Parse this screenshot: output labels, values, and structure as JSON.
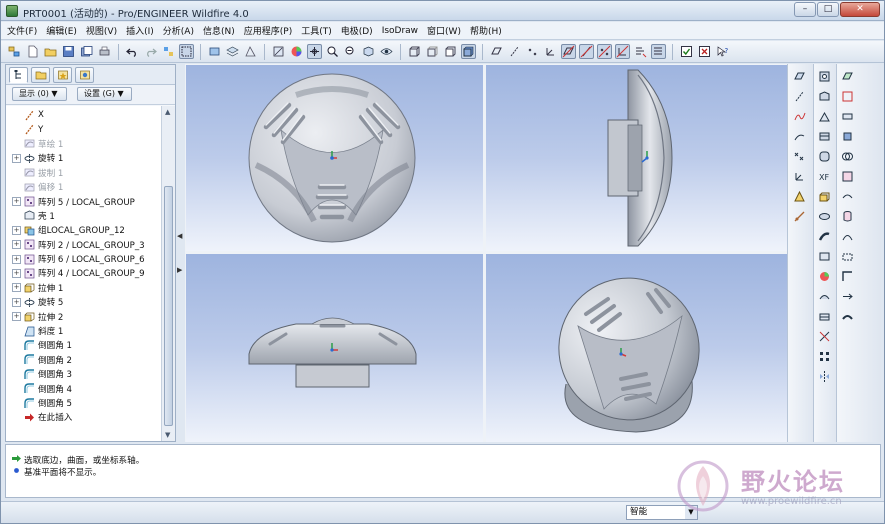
{
  "window": {
    "title": "PRT0001 (活动的) - Pro/ENGINEER Wildfire 4.0",
    "controls": {
      "minimize": "–",
      "maximize": "□",
      "close": "✕"
    }
  },
  "menu": [
    "文件(F)",
    "编辑(E)",
    "视图(V)",
    "插入(I)",
    "分析(A)",
    "信息(N)",
    "应用程序(P)",
    "工具(T)",
    "电极(D)",
    "IsoDraw",
    "窗口(W)",
    "帮助(H)"
  ],
  "navigator": {
    "show_button": "显示 (0) ▼",
    "settings_button": "设置 (G) ▼"
  },
  "tree": [
    {
      "label": "X",
      "icon": "axis-icon",
      "expandable": false,
      "dim": false
    },
    {
      "label": "Y",
      "icon": "axis-icon",
      "expandable": false,
      "dim": false
    },
    {
      "label": "草绘 1",
      "icon": "sketch-icon",
      "expandable": false,
      "dim": true
    },
    {
      "label": "旋转 1",
      "icon": "revolve-icon",
      "expandable": true,
      "dim": false
    },
    {
      "label": "拔制 1",
      "icon": "sketch-icon",
      "expandable": false,
      "dim": true
    },
    {
      "label": "偏移 1",
      "icon": "sketch-icon",
      "expandable": false,
      "dim": true
    },
    {
      "label": "阵列 5 / LOCAL_GROUP",
      "icon": "pattern-icon",
      "expandable": true,
      "dim": false
    },
    {
      "label": "壳 1",
      "icon": "shell-icon",
      "expandable": false,
      "dim": false
    },
    {
      "label": "组LOCAL_GROUP_12",
      "icon": "group-icon",
      "expandable": true,
      "dim": false
    },
    {
      "label": "阵列 2 / LOCAL_GROUP_3",
      "icon": "pattern-icon",
      "expandable": true,
      "dim": false
    },
    {
      "label": "阵列 6 / LOCAL_GROUP_6",
      "icon": "pattern-icon",
      "expandable": true,
      "dim": false
    },
    {
      "label": "阵列 4 / LOCAL_GROUP_9",
      "icon": "pattern-icon",
      "expandable": true,
      "dim": false
    },
    {
      "label": "拉伸 1",
      "icon": "extrude-icon",
      "expandable": true,
      "dim": false
    },
    {
      "label": "旋转 5",
      "icon": "revolve-icon",
      "expandable": true,
      "dim": false
    },
    {
      "label": "拉伸 2",
      "icon": "extrude-icon",
      "expandable": true,
      "dim": false
    },
    {
      "label": "斜度 1",
      "icon": "draft-icon",
      "expandable": false,
      "dim": false
    },
    {
      "label": "倒圆角 1",
      "icon": "round-icon",
      "expandable": false,
      "dim": false
    },
    {
      "label": "倒圆角 2",
      "icon": "round-icon",
      "expandable": false,
      "dim": false
    },
    {
      "label": "倒圆角 3",
      "icon": "round-icon",
      "expandable": false,
      "dim": false
    },
    {
      "label": "倒圆角 4",
      "icon": "round-icon",
      "expandable": false,
      "dim": false
    },
    {
      "label": "倒圆角 5",
      "icon": "round-icon",
      "expandable": false,
      "dim": false
    },
    {
      "label": "在此插入",
      "icon": "insert-here-icon",
      "expandable": false,
      "dim": false
    }
  ],
  "messages": [
    {
      "text": "选取底边，曲面，或坐标系轴。",
      "icon": "prompt-arrow-icon"
    },
    {
      "text": "基准平面将不显示。",
      "icon": "info-dot-icon"
    }
  ],
  "status": {
    "filter": "智能"
  },
  "watermark": {
    "text": "野火论坛",
    "url": "www.proewildfire.cn"
  },
  "colors": {
    "viewport_top": "#9eb4df",
    "viewport_bottom": "#eff3fb",
    "model": "#c9ccd3"
  }
}
